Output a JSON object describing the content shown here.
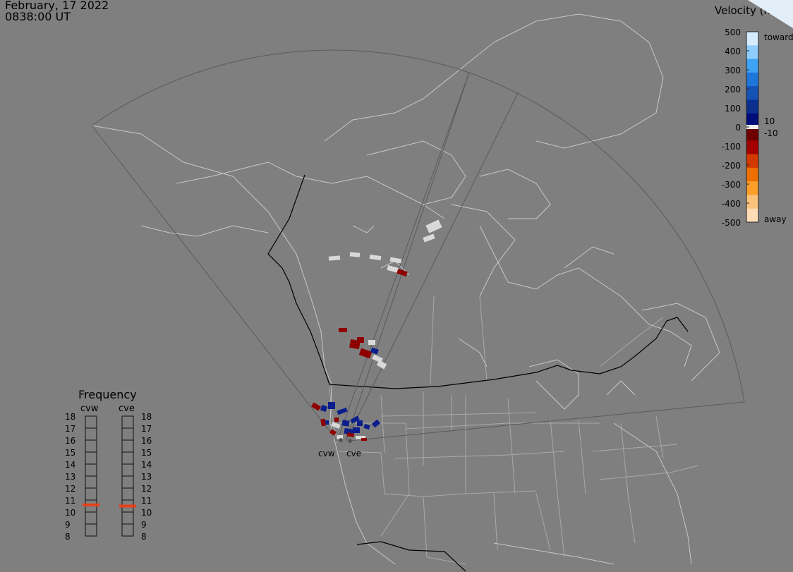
{
  "header": {
    "date": "February, 17 2022",
    "time": "0838:00 UT"
  },
  "colorbar": {
    "title": "Velocity (m/s)",
    "tick_labels": [
      "500",
      "400",
      "300",
      "200",
      "100",
      "0",
      "-100",
      "-200",
      "-300",
      "-400",
      "-500"
    ],
    "label_toward": "toward",
    "label_away": "away",
    "label_pos10": "10",
    "label_neg10": "-10",
    "colors": [
      "#d6ecfd",
      "#8ecdfb",
      "#3ea2f4",
      "#1f76da",
      "#1552b6",
      "#0a2f8e",
      "#000c78",
      "#6f0000",
      "#a50000",
      "#d13a00",
      "#ee6f00",
      "#fb9e2a",
      "#fcc27c",
      "#fedcb5"
    ]
  },
  "radars": {
    "labels": [
      "cvw",
      "cve"
    ]
  },
  "frequency": {
    "title": "Frequency",
    "columns": [
      "cvw",
      "cve"
    ],
    "ticks": [
      "18",
      "17",
      "16",
      "15",
      "14",
      "13",
      "12",
      "11",
      "10",
      "9",
      "8"
    ],
    "values_mhz": [
      10.6,
      10.5
    ],
    "marker_color": "#e8401a"
  },
  "scatter_colors": {
    "toward": "#0b1e8c",
    "away": "#8e0000",
    "ground": "#d9d9d9"
  }
}
